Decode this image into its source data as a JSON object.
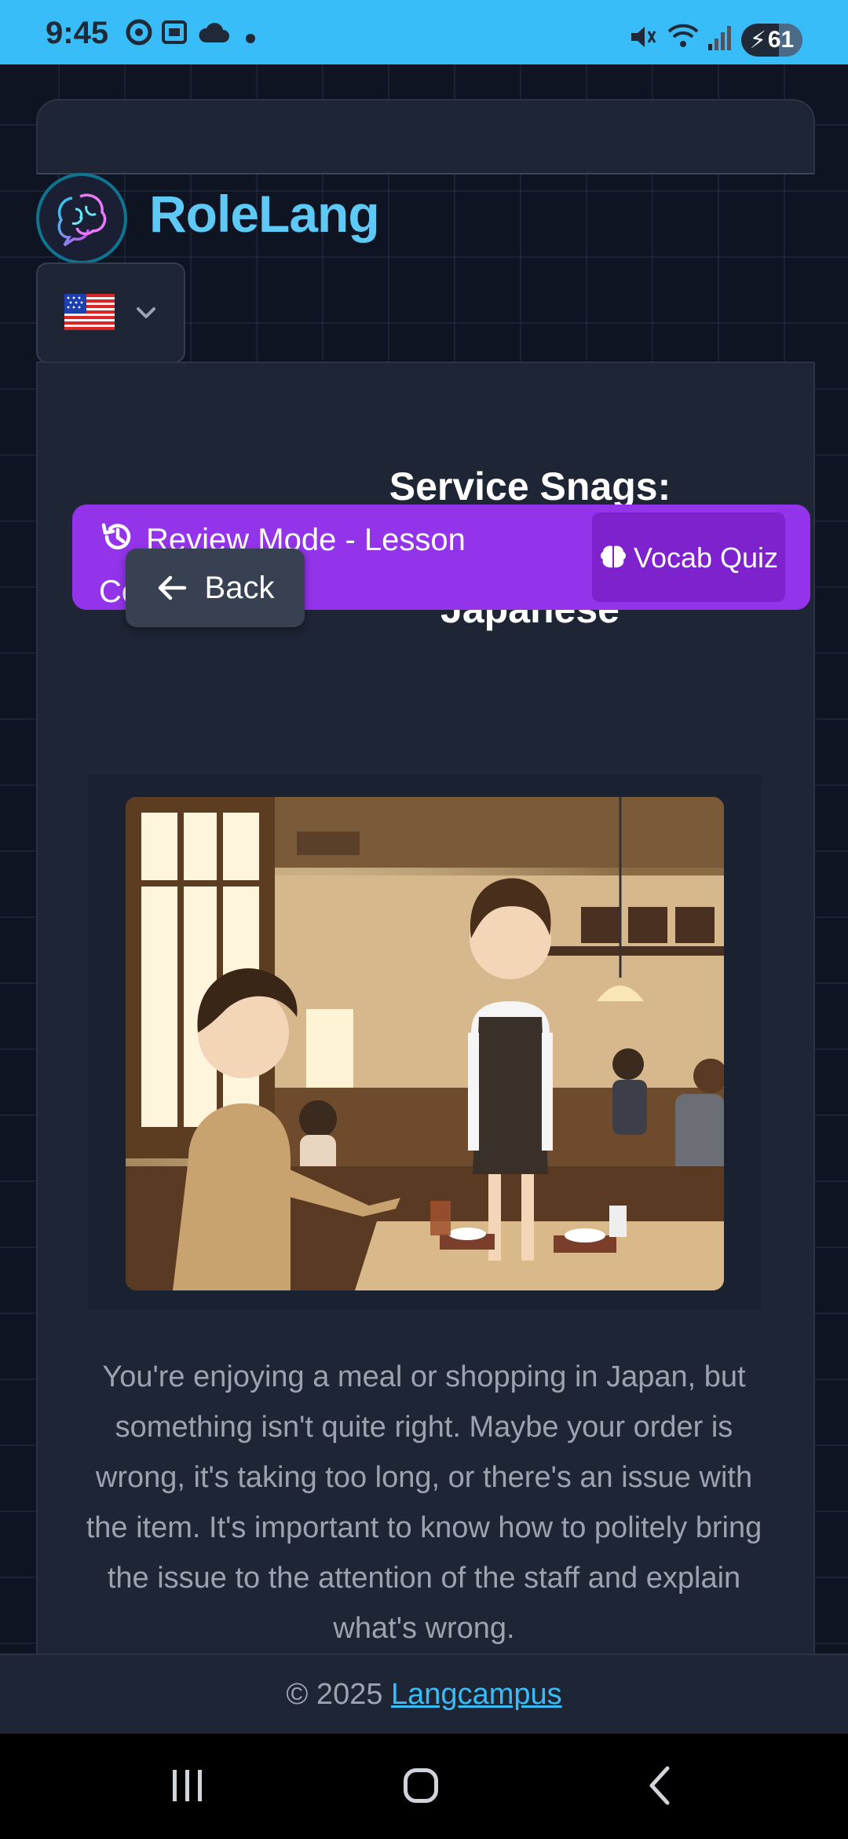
{
  "status_bar": {
    "time": "9:45",
    "battery": "61"
  },
  "app": {
    "name": "RoleLang",
    "language_flag": "us-flag"
  },
  "lesson": {
    "title": "Service Snags: Complaining in Japanese",
    "review_banner": "Review Mode - Lesson Completed",
    "vocab_quiz": "Vocab Quiz",
    "back": "Back",
    "description": "You're enjoying a meal or shopping in Japan, but something isn't quite right. Maybe your order is wrong, it's taking too long, or there's an issue with the item. It's important to know how to politely bring the issue to the attention of the staff and explain what's wrong."
  },
  "footer": {
    "copyright": "© 2025",
    "link": "Langcampus"
  },
  "colors": {
    "accent": "#38bdf8",
    "review": "#9333ea",
    "quiz": "#7e22ce"
  }
}
